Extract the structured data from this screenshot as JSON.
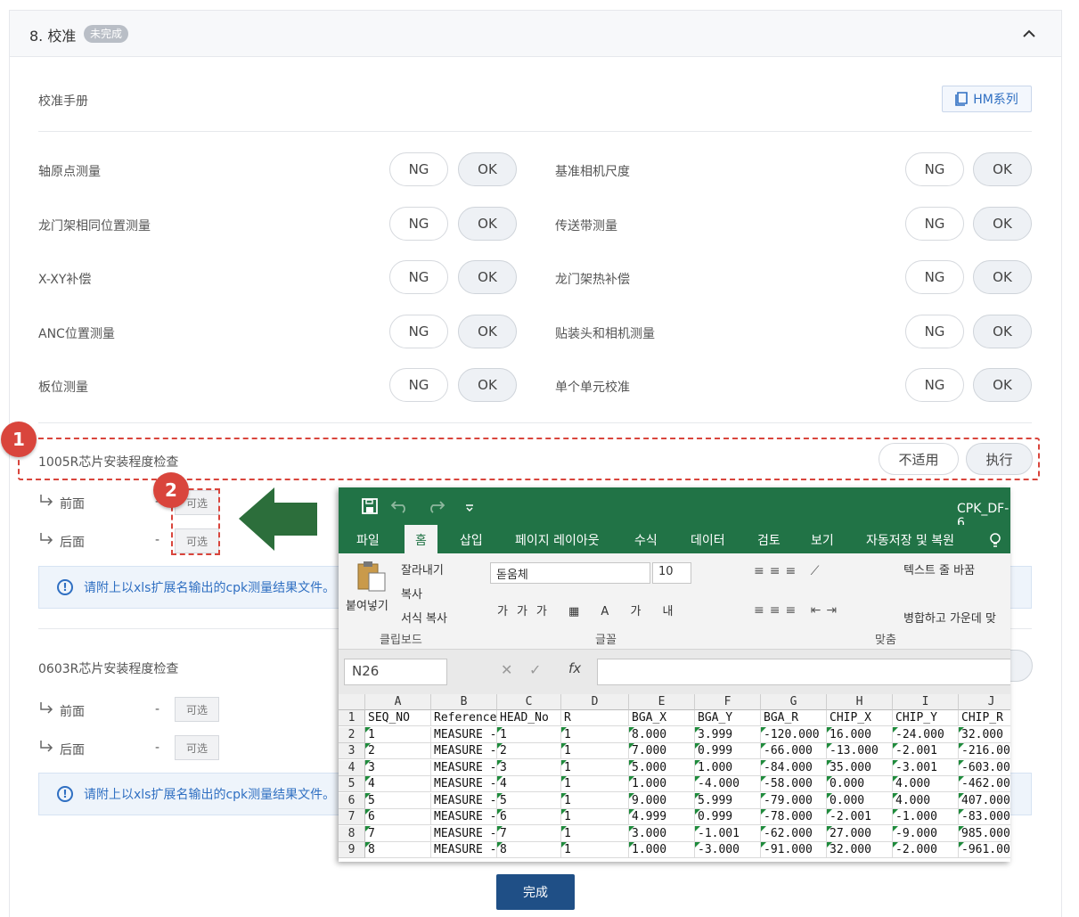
{
  "header": {
    "title": "8. 校准",
    "badge": "未完成"
  },
  "manual": {
    "label": "校准手册",
    "button": "HM系列"
  },
  "items_left": [
    {
      "label": "轴原点测量",
      "ng": "NG",
      "ok": "OK"
    },
    {
      "label": "龙门架相同位置测量",
      "ng": "NG",
      "ok": "OK"
    },
    {
      "label": "X-XY补偿",
      "ng": "NG",
      "ok": "OK"
    },
    {
      "label": "ANC位置测量",
      "ng": "NG",
      "ok": "OK"
    },
    {
      "label": "板位测量",
      "ng": "NG",
      "ok": "OK"
    }
  ],
  "items_right": [
    {
      "label": "基准相机尺度",
      "ng": "NG",
      "ok": "OK"
    },
    {
      "label": "传送带测量",
      "ng": "NG",
      "ok": "OK"
    },
    {
      "label": "龙门架热补偿",
      "ng": "NG",
      "ok": "OK"
    },
    {
      "label": "贴装头和相机测量",
      "ng": "NG",
      "ok": "OK"
    },
    {
      "label": "单个单元校准",
      "ng": "NG",
      "ok": "OK"
    }
  ],
  "section1005": {
    "title": "1005R芯片安装程度检查",
    "na": "不适用",
    "exec": "执行",
    "front": "前面",
    "back": "后面",
    "dash": "-",
    "optional": "可选",
    "info": "请附上以xls扩展名输出的cpk测量结果文件。"
  },
  "section0603": {
    "title": "0603R芯片安装程度检查",
    "front": "前面",
    "back": "后面",
    "dash": "-",
    "optional": "可选",
    "info": "请附上以xls扩展名输出的cpk测量结果文件。"
  },
  "markers": {
    "one": "1",
    "two": "2"
  },
  "done_button": "完成",
  "excel": {
    "filename": "CPK_DF-6",
    "tabs": [
      "파일",
      "홈",
      "삽입",
      "페이지 레이아웃",
      "수식",
      "데이터",
      "검토",
      "보기",
      "자동저장 및 복원"
    ],
    "ribbon": {
      "paste": "붙여넣기",
      "cut": "잘라내기",
      "copy": "복사",
      "format_copy": "서식 복사",
      "clipboard": "클립보드",
      "font_name": "돋움체",
      "font_size": "10",
      "font": "글꼴",
      "wrap": "텍스트 줄 바꿈",
      "merge": "병합하고 가운데 맞",
      "align": "맞춤"
    },
    "namebox": "N26",
    "columns": [
      "A",
      "B",
      "C",
      "D",
      "E",
      "F",
      "G",
      "H",
      "I",
      "J"
    ],
    "rows": [
      [
        "SEQ_NO",
        "Reference",
        "HEAD_No",
        "R",
        "BGA_X",
        "BGA_Y",
        "BGA_R",
        "CHIP_X",
        "CHIP_Y",
        "CHIP_R"
      ],
      [
        "1",
        "MEASURE -",
        "1",
        "1",
        "8.000",
        "3.999",
        "-120.000",
        "16.000",
        "-24.000",
        "32.000"
      ],
      [
        "2",
        "MEASURE -",
        "2",
        "1",
        "7.000",
        "0.999",
        "-66.000",
        "-13.000",
        "-2.001",
        "-216.00"
      ],
      [
        "3",
        "MEASURE -",
        "3",
        "1",
        "5.000",
        "1.000",
        "-84.000",
        "35.000",
        "-3.001",
        "-603.00"
      ],
      [
        "4",
        "MEASURE -",
        "4",
        "1",
        "1.000",
        "-4.000",
        "-58.000",
        "0.000",
        "4.000",
        "-462.00"
      ],
      [
        "5",
        "MEASURE -",
        "5",
        "1",
        "9.000",
        "5.999",
        "-79.000",
        "0.000",
        "4.000",
        "407.000"
      ],
      [
        "6",
        "MEASURE -",
        "6",
        "1",
        "4.999",
        "0.999",
        "-78.000",
        "-2.001",
        "-1.000",
        "-83.000"
      ],
      [
        "7",
        "MEASURE -",
        "7",
        "1",
        "3.000",
        "-1.001",
        "-62.000",
        "27.000",
        "-9.000",
        "985.000"
      ],
      [
        "8",
        "MEASURE -",
        "8",
        "1",
        "1.000",
        "-3.000",
        "-91.000",
        "32.000",
        "-2.000",
        "-961.00"
      ]
    ]
  },
  "colors": {
    "accent_red": "#d9453c",
    "excel_green": "#217346",
    "primary_blue": "#1f4f86",
    "arrow_green": "#2c6e3b"
  }
}
